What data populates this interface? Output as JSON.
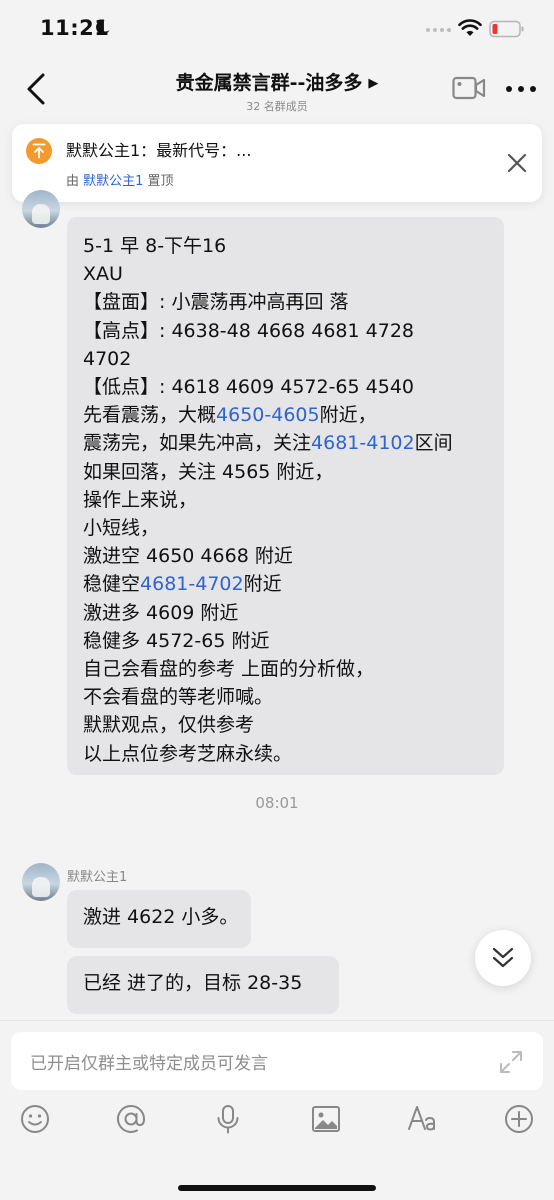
{
  "status_bar": {
    "time": "11:21"
  },
  "nav": {
    "title": "贵金属禁言群--油多多",
    "subtitle": "32 名群成员"
  },
  "pinned": {
    "text": "默默公主1：最新代号：...",
    "by_prefix": "由 ",
    "by_name": "默默公主1",
    "by_suffix": " 置顶"
  },
  "messages": [
    {
      "sender": "默默公主1",
      "lines": [
        [
          "5-1  早 8-下午16"
        ],
        [
          "XAU"
        ],
        [
          "【盘面】: 小震荡再冲高再回 落"
        ],
        [
          "【高点】: 4638-48   4668   4681   4728"
        ],
        [
          "4702"
        ],
        [
          "【低点】: 4618   4609   4572-65   4540"
        ],
        [
          "先看震荡，大概",
          {
            "hl": "4650-4605"
          },
          "附近，"
        ],
        [
          "震荡完，如果先冲高，关注",
          {
            "hl": "4681-4102"
          },
          "区间"
        ],
        [
          "如果回落，关注 4565 附近，"
        ],
        [
          "操作上来说，"
        ],
        [
          "小短线，"
        ],
        [
          "激进空 4650   4668 附近"
        ],
        [
          "稳健空",
          {
            "hl": "4681-4702"
          },
          "附近"
        ],
        [
          "激进多 4609 附近"
        ],
        [
          "稳健多 4572-65 附近"
        ],
        [
          "自己会看盘的参考 上面的分析做，"
        ],
        [
          "不会看盘的等老师喊。"
        ],
        [
          "默默观点，仅供参考"
        ],
        [
          "以上点位参考芝麻永续。"
        ]
      ]
    }
  ],
  "time_divider": "08:01",
  "messages2": {
    "sender": "默默公主1",
    "bubble1": "激进 4622 小多。",
    "bubble2": "已经 进了的，目标 28-35"
  },
  "input": {
    "placeholder": "已开启仅群主或特定成员可发言"
  },
  "colors": {
    "accent": "#2f64cf",
    "pin": "#f39a2e",
    "bubble": "#e5e5e8",
    "battery_low": "#e53935"
  },
  "icons": [
    "back-icon",
    "video-call-icon",
    "more-icon",
    "pin-icon",
    "close-icon",
    "scroll-down-icon",
    "expand-icon",
    "emoji-icon",
    "mention-icon",
    "microphone-icon",
    "image-icon",
    "font-icon",
    "plus-icon"
  ]
}
